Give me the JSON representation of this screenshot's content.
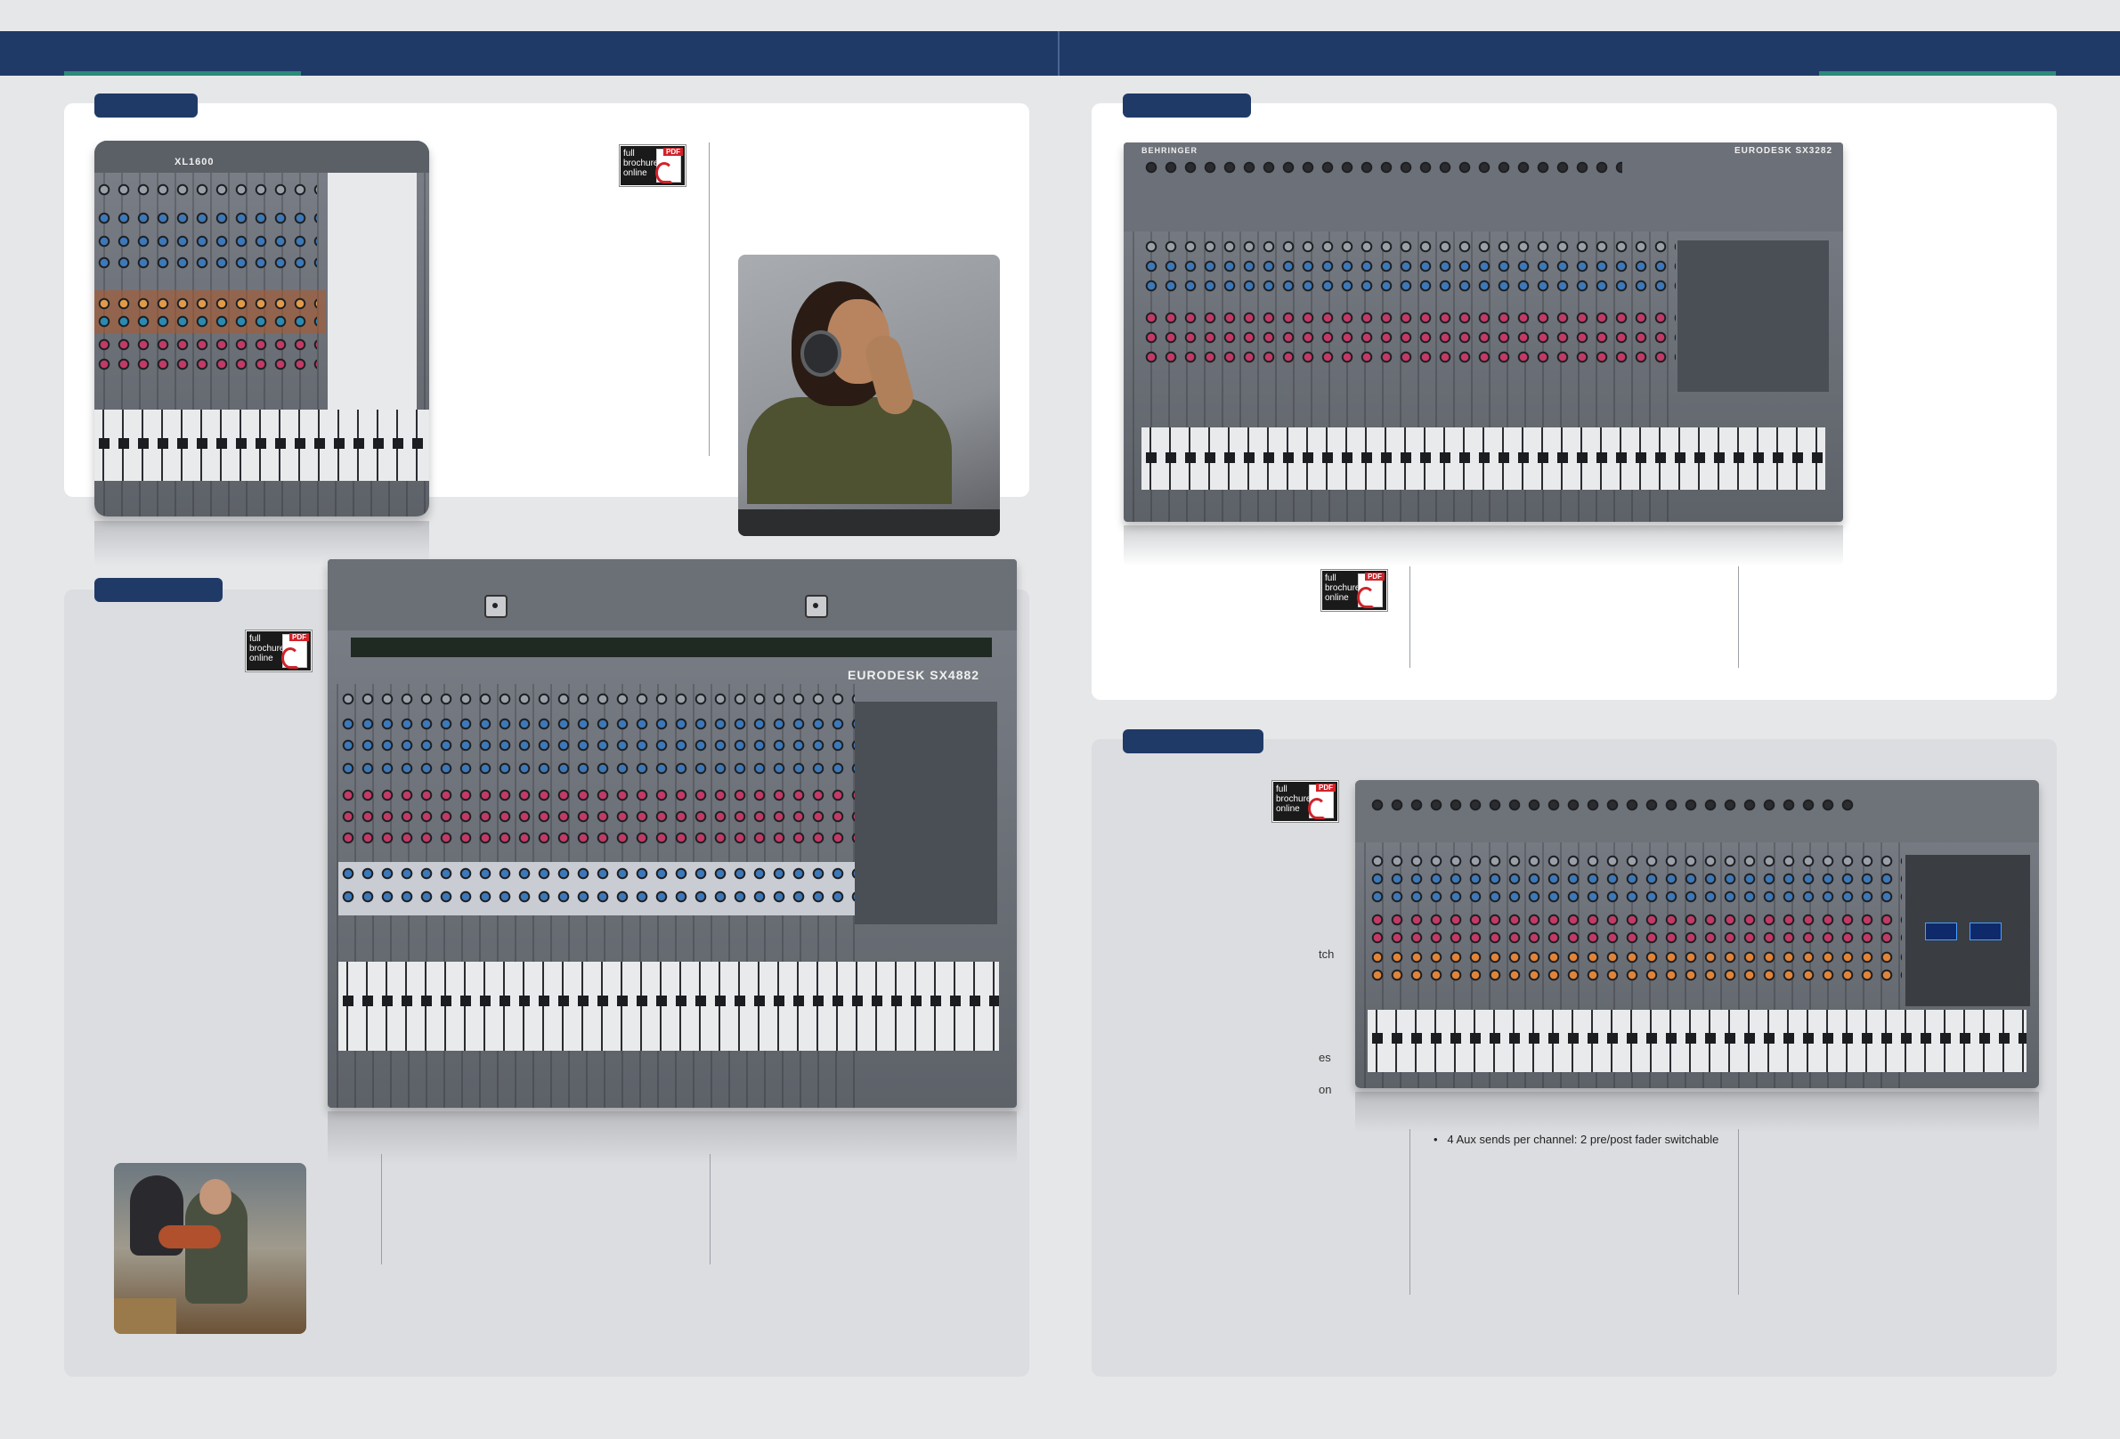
{
  "header": {
    "bar_color": "#203a67",
    "accent_color": "#2e8a7a"
  },
  "pdf_badge": {
    "text": "full\nbrochure\nonline",
    "tag": "PDF",
    "icon": "pdf-document-icon"
  },
  "products": {
    "xl1600": {
      "logo": "XL1600"
    },
    "sx4882": {
      "logo": "EURODESK SX4882"
    },
    "sx3282": {
      "brand": "BEHRINGER",
      "logo": "EURODESK SX3282"
    },
    "sx3242fx": {
      "logo": ""
    }
  },
  "text_fragments": {
    "aux_sends": "4 Aux sends per channel: 2 pre/post fader switchable",
    "frag_tch": "tch",
    "frag_es": "es",
    "frag_on": "on"
  }
}
